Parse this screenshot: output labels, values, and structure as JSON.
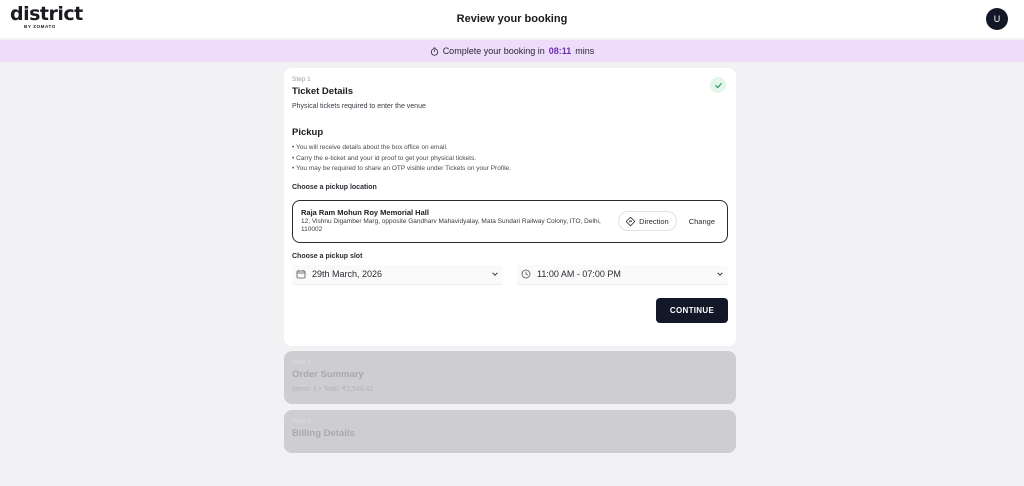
{
  "header": {
    "logo_word": "district",
    "logo_sub": "BY ZOMATO",
    "title": "Review your booking",
    "avatar_initial": "U"
  },
  "timer": {
    "prefix": "Complete your booking in",
    "time": "08:11",
    "suffix": "mins",
    "icon": "stopwatch-icon"
  },
  "step1": {
    "step_label": "Step 1",
    "title": "Ticket Details",
    "subtitle": "Physical tickets required to enter the venue",
    "status_icon": "check-icon",
    "pickup": {
      "title": "Pickup",
      "bullets": [
        "You will receive details about the box office on email.",
        "Carry the e-ticket and your id proof to get your physical tickets.",
        "You may be required to share an OTP visible under Tickets on your Profile."
      ]
    },
    "location": {
      "label": "Choose a pickup location",
      "name": "Raja Ram Mohun Roy Memorial Hall",
      "address": "12, Vishnu Digamber Marg, opposite Gandharv Mahavidyalay, Mata Sundari Railway Colony, ITO, Delhi, 110002",
      "direction_label": "Direction",
      "change_label": "Change"
    },
    "slot": {
      "label": "Choose a pickup slot",
      "date": "29th March, 2026",
      "time": "11:00 AM - 07:00 PM"
    },
    "continue_label": "CONTINUE"
  },
  "step2": {
    "step_label": "Step 2",
    "title": "Order Summary",
    "meta": "Items: 1 • Total: ₹1,540.42"
  },
  "step3": {
    "step_label": "Step 3",
    "title": "Billing Details"
  },
  "colors": {
    "banner": "#eedcfa",
    "timer_accent": "#6a2fb8",
    "primary_button": "#121827",
    "success": "#2e9b57"
  }
}
